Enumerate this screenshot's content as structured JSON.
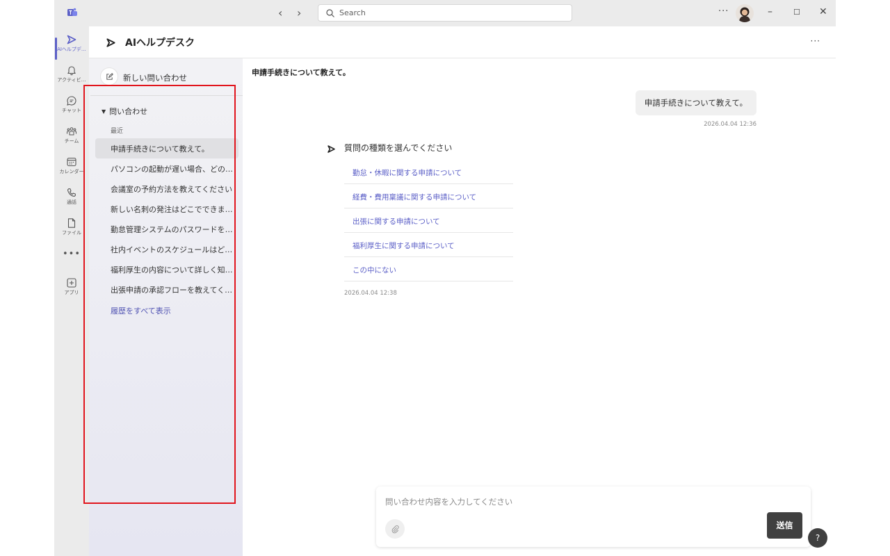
{
  "titlebar": {
    "search_placeholder": "Search",
    "more_label": "···",
    "minimize_label": "–",
    "maximize_label": "☐",
    "close_label": "✕",
    "back_label": "‹",
    "forward_label": "›"
  },
  "rail": {
    "items": [
      {
        "label": "AIヘルプデ…",
        "icon": "send-arrow-icon",
        "active": true
      },
      {
        "label": "アクティビ…",
        "icon": "bell-icon"
      },
      {
        "label": "チャット",
        "icon": "chat-icon"
      },
      {
        "label": "チーム",
        "icon": "teams-icon"
      },
      {
        "label": "カレンダー",
        "icon": "calendar-icon"
      },
      {
        "label": "通話",
        "icon": "phone-icon"
      },
      {
        "label": "ファイル",
        "icon": "file-icon"
      },
      {
        "label": "アプリ",
        "icon": "add-app-icon"
      }
    ],
    "more_label": "•••"
  },
  "header": {
    "title": "AIヘルプデスク",
    "more_label": "···"
  },
  "sidepanel": {
    "new_inquiry_label": "新しい問い合わせ",
    "section_label": "問い合わせ",
    "recent_label": "最近",
    "history": [
      {
        "label": "申請手続きについて教えて。",
        "selected": true
      },
      {
        "label": "パソコンの起動が遅い場合、どの…"
      },
      {
        "label": "会議室の予約方法を教えてください"
      },
      {
        "label": "新しい名刺の発注はどこでできま…"
      },
      {
        "label": "勤怠管理システムのパスワードを…"
      },
      {
        "label": "社内イベントのスケジュールはど…"
      },
      {
        "label": "福利厚生の内容について詳しく知…"
      },
      {
        "label": "出張申請の承認フローを教えてく…"
      }
    ],
    "show_all_label": "履歴をすべて表示"
  },
  "conversation": {
    "title": "申請手続きについて教えて。",
    "user_message": "申請手続きについて教えて。",
    "user_timestamp": "2026.04.04 12:36",
    "bot_question": "質問の種類を選んでください",
    "choices": [
      "勤怠・休暇に関する申請について",
      "経費・費用稟議に関する申請について",
      "出張に関する申請について",
      "福利厚生に関する申請について",
      "この中にない"
    ],
    "bot_timestamp": "2026.04.04 12:38"
  },
  "composer": {
    "placeholder": "問い合わせ内容を入力してください",
    "send_label": "送信"
  },
  "help_label": "?",
  "colors": {
    "accent": "#5b5fc7",
    "highlight": "#e1141c",
    "send_button": "#404040"
  }
}
